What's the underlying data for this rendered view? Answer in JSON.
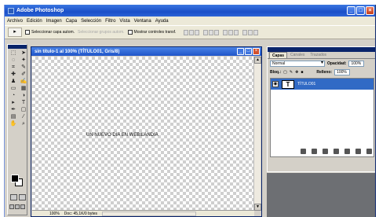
{
  "app": {
    "title": "Adobe Photoshop",
    "window_buttons": [
      "_",
      "□",
      "×"
    ]
  },
  "menu": [
    "Archivo",
    "Edición",
    "Imagen",
    "Capa",
    "Selección",
    "Filtro",
    "Vista",
    "Ventana",
    "Ayuda"
  ],
  "options": {
    "tool_glyph": "▸",
    "auto_select": "Seleccionar capa autom.",
    "auto_select_group": "Seleccionar grupos autom.",
    "show_transform": "Mostrar controles transf."
  },
  "document": {
    "title": "sin título-1 al 100% (TÍTULO01, Gris/8)",
    "canvas_text": "UN NUEVO DIA EN WEBILANDIA",
    "buttons": [
      "_",
      "□",
      "×"
    ],
    "zoom": "100%",
    "status_info": "Doc: 45,1K/0 bytes"
  },
  "layers_panel": {
    "tabs": [
      "Capas",
      "Canales",
      "Trazados"
    ],
    "blend_mode": "Normal",
    "opacity_label": "Opacidad:",
    "opacity_value": "100%",
    "lock_label": "Bloq.:",
    "fill_label": "Relleno:",
    "fill_value": "100%",
    "layers": [
      {
        "name": "TÍTULO01",
        "thumb": "T",
        "visible": true,
        "selected": true
      }
    ]
  },
  "colors": {
    "title_bar": "#1a4fc8",
    "layer_selected": "#316ac5",
    "panel_bottom": "#6d6f73"
  }
}
